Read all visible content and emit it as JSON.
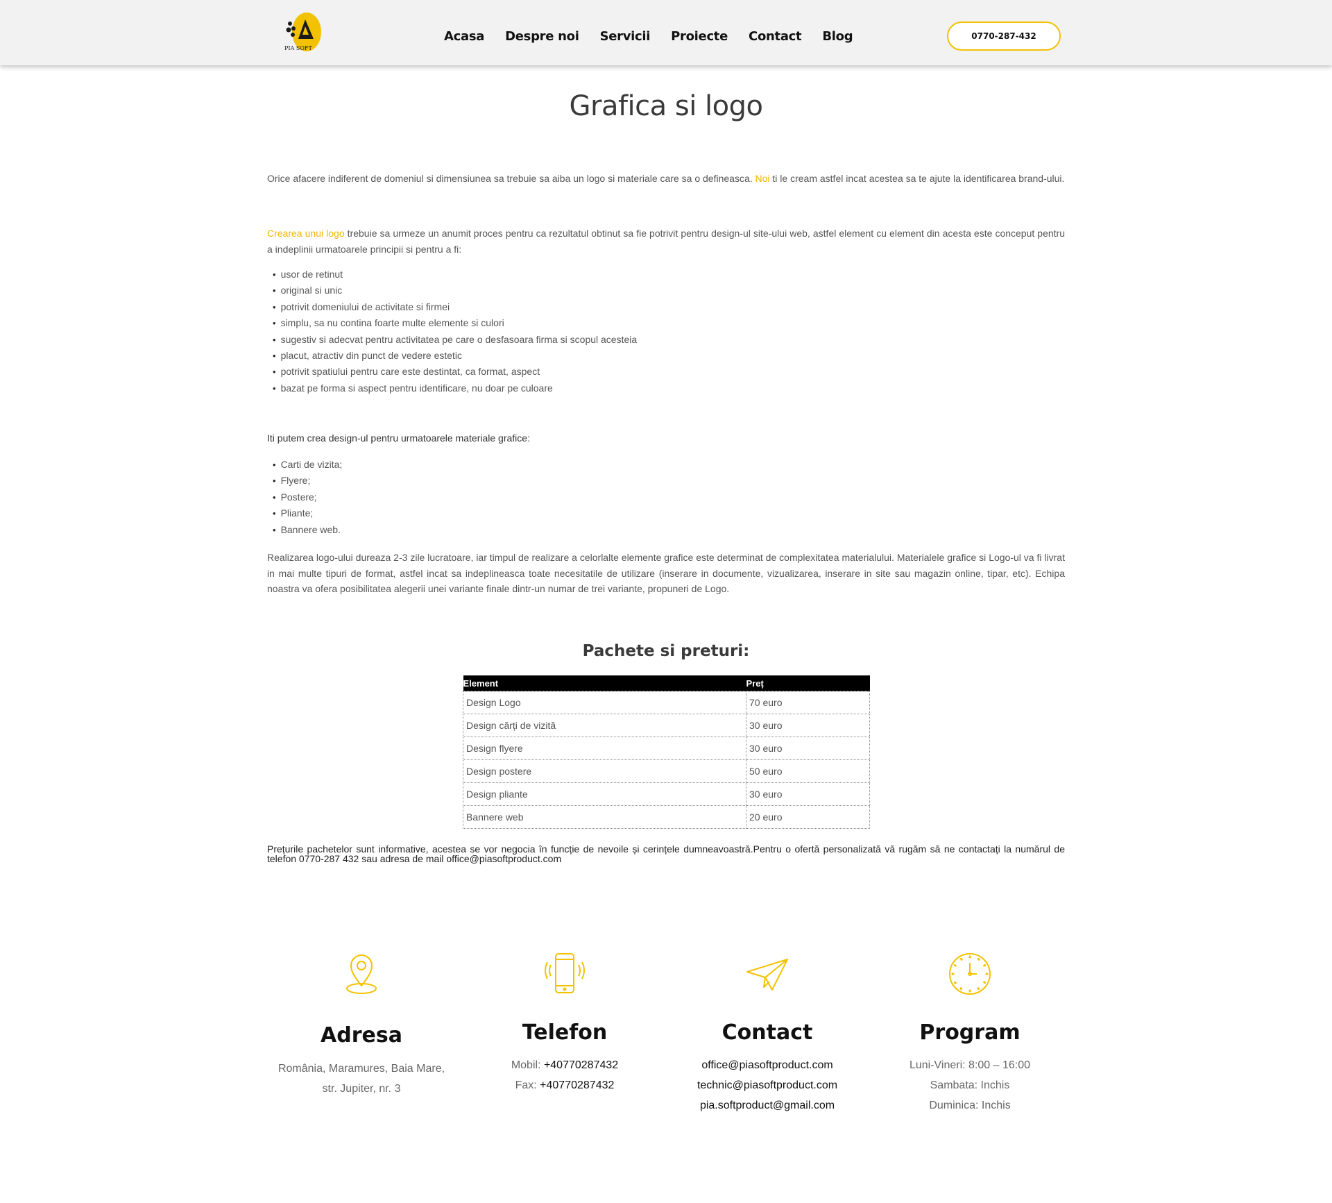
{
  "header": {
    "logo_icon": "pia-soft-product-logo",
    "logo_text": "PIA SOFT",
    "nav": [
      "Acasa",
      "Despre noi",
      "Servicii",
      "Proiecte",
      "Contact",
      "Blog"
    ],
    "phone": "0770-287-432",
    "accent_color": "#f2c200"
  },
  "main": {
    "title": "Grafica si logo",
    "intro": {
      "before": "Orice afacere indiferent de domeniul si dimensiunea sa trebuie sa aiba un logo si materiale care sa o defineasca. ",
      "link": "Noi",
      "after": " ti le cream astfel incat acestea sa te ajute la identificarea brand-ului."
    },
    "para2": {
      "link": "Crearea unui logo",
      "after": " trebuie sa urmeze un anumit proces pentru ca rezultatul obtinut sa fie potrivit pentru design-ul site-ului web, astfel element cu element din acesta este conceput pentru a indeplinii urmatoarele principii si pentru a fi:"
    },
    "principles": [
      "usor de retinut",
      "original si unic",
      "potrivit domeniului de activitate si firmei",
      "simplu, sa nu contina foarte multe elemente si culori",
      "sugestiv si adecvat pentru activitatea pe care o desfasoara firma si scopul acesteia",
      "placut, atractiv din punct de vedere estetic",
      "potrivit spatiului pentru care este destintat, ca format, aspect",
      "bazat pe forma si aspect pentru identificare, nu doar pe culoare"
    ],
    "materials_heading": "Iti putem crea design-ul pentru urmatoarele materiale grafice:",
    "materials": [
      "Carti de vizita;",
      "Flyere;",
      "Postere;",
      "Pliante;",
      "Bannere web."
    ],
    "para3": "Realizarea logo-ului dureaza 2-3 zile lucratoare, iar timpul de realizare a celorlalte elemente grafice este determinat de complexitatea materialului. Materialele grafice si Logo-ul va fi livrat in mai multe tipuri de format, astfel incat sa indeplineasca toate necesitatile de utilizare (inserare in documente, vizualizarea, inserare in site sau magazin online, tipar, etc). Echipa noastra va ofera posibilitatea alegerii unei variante finale dintr-un numar de trei variante, propuneri de Logo.",
    "packages_title": "Pachete si preturi:",
    "table": {
      "headers": [
        "Element",
        "Preț"
      ],
      "rows": [
        [
          "Design Logo",
          "70 euro"
        ],
        [
          "Design cărți de vizită",
          "30 euro"
        ],
        [
          "Design flyere",
          "30 euro"
        ],
        [
          "Design postere",
          "50 euro"
        ],
        [
          "Design pliante",
          "30 euro"
        ],
        [
          "Bannere web",
          "20 euro"
        ]
      ]
    },
    "note": "Prețurile pachetelor sunt informative, acestea se vor negocia în funcție de nevoile și cerințele dumneavoastră.Pentru o ofertă personalizată vă rugăm să ne contactați la numărul de telefon 0770-287 432 sau adresa de mail office@piasoftproduct.com"
  },
  "footer": {
    "adresa": {
      "icon": "map-pin-icon",
      "title": "Adresa",
      "line1": "România, Maramures, Baia Mare,",
      "line2": "str. Jupiter, nr. 3"
    },
    "telefon": {
      "icon": "smartphone-icon",
      "title": "Telefon",
      "mobil_label": "Mobil: ",
      "mobil": "+40770287432",
      "fax_label": "Fax: ",
      "fax": "+40770287432"
    },
    "contact": {
      "icon": "paper-plane-icon",
      "title": "Contact",
      "emails": [
        "office@piasoftproduct.com",
        "technic@piasoftproduct.com",
        "pia.softproduct@gmail.com"
      ]
    },
    "program": {
      "icon": "clock-icon",
      "title": "Program",
      "lines": [
        "Luni-Vineri: 8:00 – 16:00",
        "Sambata: Inchis",
        "Duminica: Inchis"
      ]
    }
  }
}
